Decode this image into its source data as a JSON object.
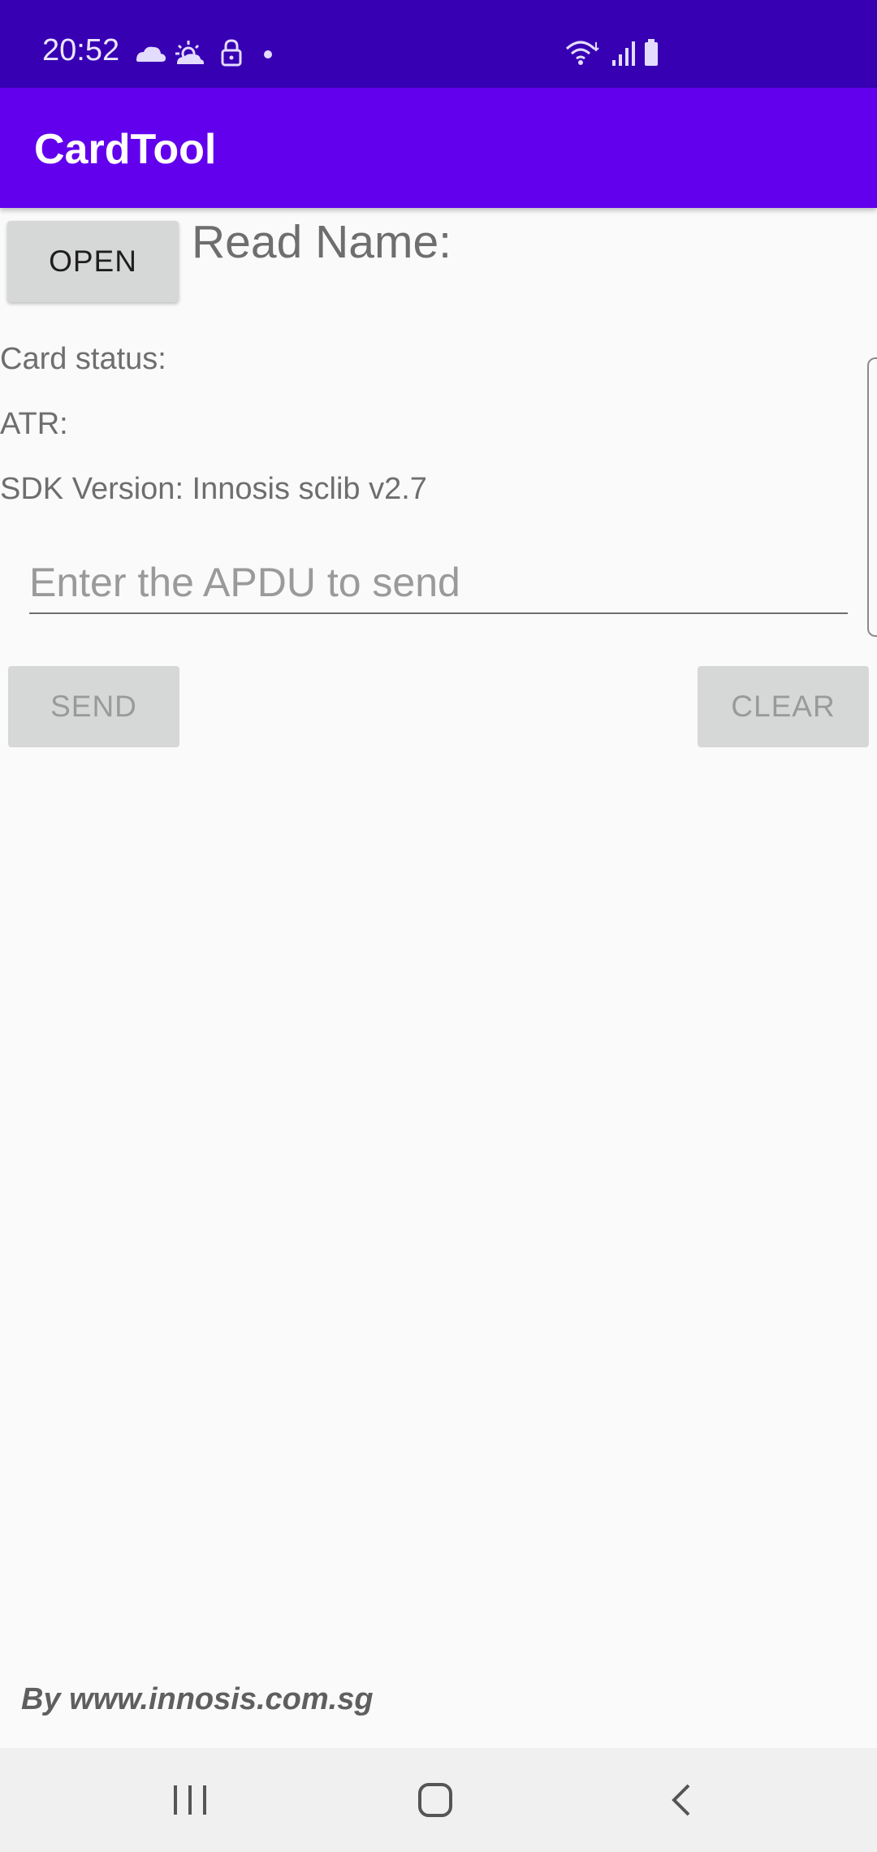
{
  "status_bar": {
    "time": "20:52",
    "icons": [
      "cloud-icon",
      "sun-cloud-icon",
      "lock-icon",
      "notification-dot-icon",
      "wifi-icon",
      "signal-icon",
      "battery-icon"
    ]
  },
  "app_bar": {
    "title": "CardTool"
  },
  "main": {
    "open_label": "OPEN",
    "read_name_label": "Read Name:",
    "card_status_label": "Card status:",
    "atr_label": "ATR:",
    "sdk_version_label": "SDK Version: Innosis sclib v2.7",
    "apdu_placeholder": "Enter the APDU to send",
    "apdu_value": "",
    "send_label": "SEND",
    "clear_label": "CLEAR"
  },
  "footer": {
    "credit": "By www.innosis.com.sg"
  },
  "nav_bar": {
    "buttons": [
      "recents-icon",
      "home-icon",
      "back-icon"
    ]
  },
  "colors": {
    "status_bar": "#3700b3",
    "app_bar": "#6200ee",
    "background": "#fafafa",
    "button": "#d6d7d7"
  }
}
